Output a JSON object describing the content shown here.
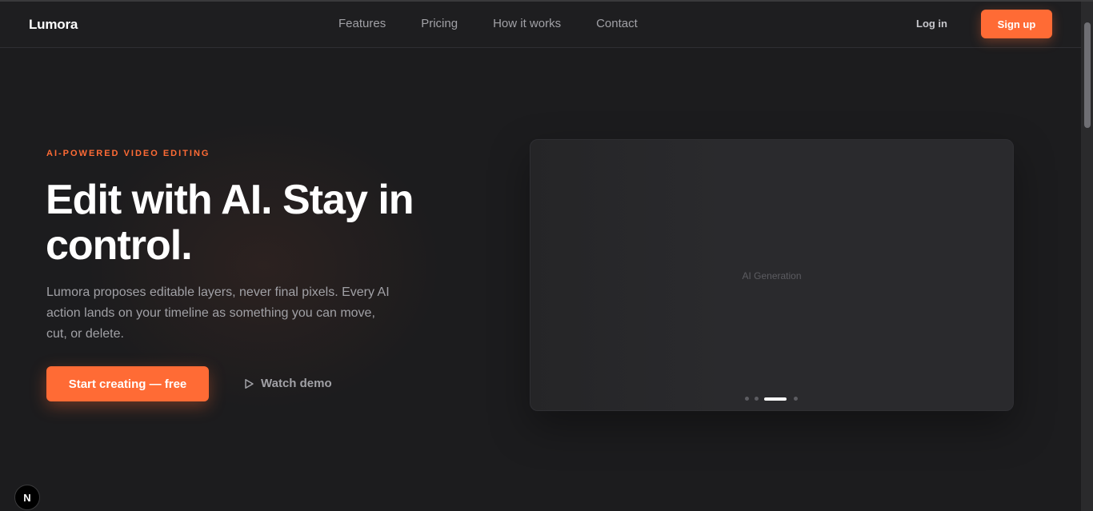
{
  "brand": {
    "name": "Lumora",
    "accent": "#ff6b35"
  },
  "nav": {
    "items": [
      "Features",
      "Pricing",
      "How it works",
      "Contact"
    ],
    "login_label": "Log in",
    "signup_label": "Sign up"
  },
  "hero": {
    "eyebrow": "AI-POWERED VIDEO EDITING",
    "headline": "Edit with AI. Stay in control.",
    "lede": "Lumora proposes editable layers, never final pixels. Every AI action lands on your timeline as something you can move, cut, or delete.",
    "cta_primary": "Start creating — free",
    "cta_secondary": "Watch demo",
    "cta_secondary_icon": "play-icon"
  },
  "preview": {
    "label": "AI Generation",
    "slides_count": 4,
    "active_slide": 3
  },
  "dev_badge": {
    "letter": "N"
  }
}
